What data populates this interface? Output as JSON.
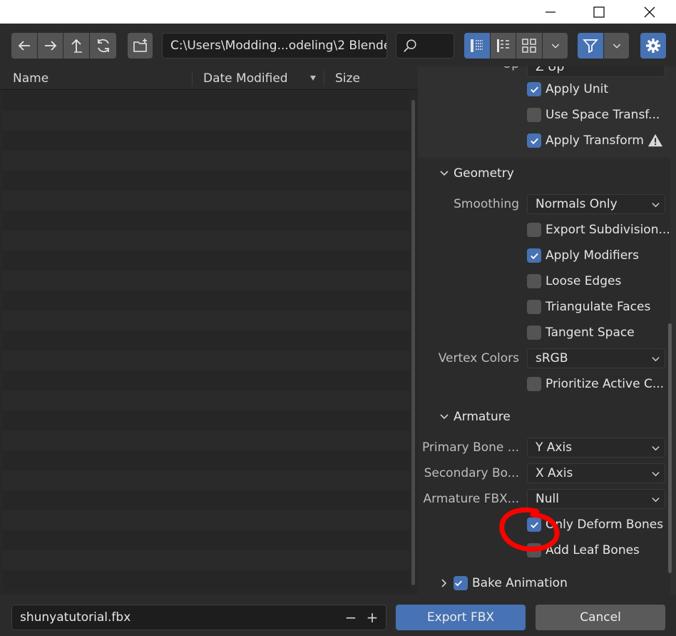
{
  "window": {
    "minimize_icon": "minimize-icon",
    "maximize_icon": "maximize-icon",
    "close_icon": "close-icon"
  },
  "toolbar": {
    "path": "C:\\Users\\Modding...odeling\\2 Blender\\",
    "search_value": "",
    "icons": [
      "back-arrow-icon",
      "forward-arrow-icon",
      "parent-directory-icon",
      "refresh-icon",
      "new-folder-icon",
      "search-icon",
      "vertical-list-icon",
      "horizontal-list-icon",
      "thumbnails-icon",
      "chevron-down-icon",
      "filter-icon",
      "gear-icon"
    ],
    "accent_color": "#4772b3"
  },
  "file_list": {
    "columns": [
      "Name",
      "Date Modified",
      "Size"
    ],
    "sort_column": "Date Modified",
    "rows": []
  },
  "settings": {
    "top_cut_label": "Up",
    "top_cut_value": "Z Up",
    "transform": [
      {
        "label": "Apply Unit",
        "checked": true
      },
      {
        "label": "Use Space Transf...",
        "checked": false
      },
      {
        "label": "Apply Transform",
        "checked": true,
        "warning": true
      }
    ],
    "geometry": {
      "title": "Geometry",
      "smoothing_label": "Smoothing",
      "smoothing_value": "Normals Only",
      "checks": [
        {
          "label": "Export Subdivision...",
          "checked": false
        },
        {
          "label": "Apply Modifiers",
          "checked": true
        },
        {
          "label": "Loose Edges",
          "checked": false
        },
        {
          "label": "Triangulate Faces",
          "checked": false
        },
        {
          "label": "Tangent Space",
          "checked": false
        }
      ],
      "vertex_colors_label": "Vertex Colors",
      "vertex_colors_value": "sRGB",
      "prioritize": {
        "label": "Prioritize Active C...",
        "checked": false
      }
    },
    "armature": {
      "title": "Armature",
      "primary_label": "Primary Bone ...",
      "primary_value": "Y Axis",
      "secondary_label": "Secondary Bo...",
      "secondary_value": "X Axis",
      "fbx_label": "Armature FBX...",
      "fbx_value": "Null",
      "checks": [
        {
          "label": "Only Deform Bones",
          "checked": true
        },
        {
          "label": "Add Leaf Bones",
          "checked": false
        }
      ]
    },
    "bake_animation": {
      "label": "Bake Animation",
      "checked": true
    }
  },
  "bottom": {
    "filename": "shunyatutorial.fbx",
    "minus": "−",
    "plus": "+",
    "export_label": "Export FBX",
    "cancel_label": "Cancel"
  }
}
